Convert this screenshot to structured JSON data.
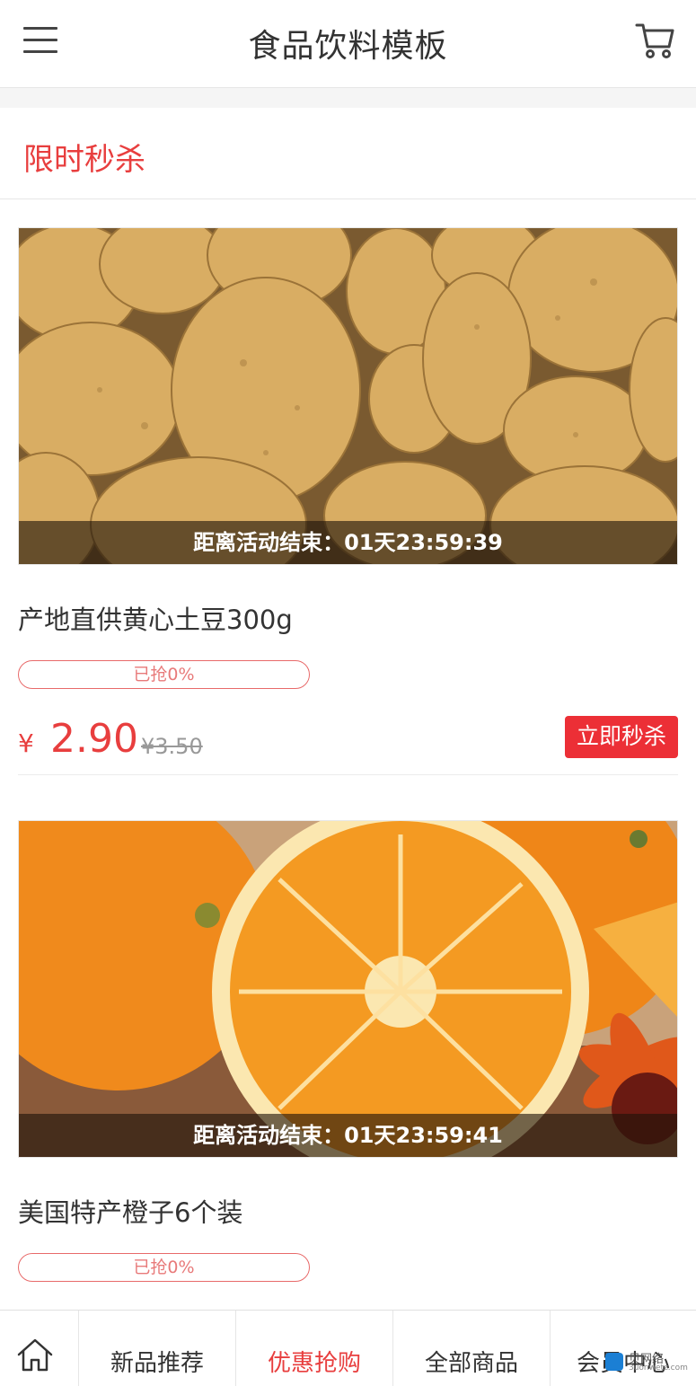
{
  "header": {
    "title": "食品饮料模板"
  },
  "section": {
    "title": "限时秒杀"
  },
  "products": [
    {
      "countdown": "距离活动结束：01天23:59:39",
      "name": "产地直供黄心土豆300g",
      "progress": "已抢0%",
      "progress_value": 0,
      "currency": "¥",
      "price": "2.90",
      "old_price": "¥3.50",
      "buy_label": "立即秒杀"
    },
    {
      "countdown": "距离活动结束：01天23:59:41",
      "name": "美国特产橙子6个装",
      "progress": "已抢0%",
      "progress_value": 0
    }
  ],
  "bottom_nav": {
    "items": [
      "新品推荐",
      "优惠抢购",
      "全部商品",
      "会员中心"
    ],
    "active": "优惠抢购"
  },
  "watermark": {
    "text": "贝网络",
    "sub": "3uonwetz.com"
  },
  "colors": {
    "accent": "#e83e3e",
    "button": "#ec2f36"
  }
}
